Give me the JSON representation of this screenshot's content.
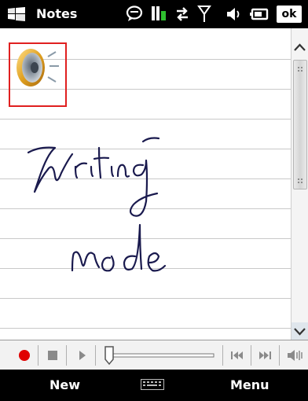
{
  "titlebar": {
    "app_title": "Notes",
    "icons": [
      "windows-flag-icon",
      "messaging-icon",
      "battery-charging-icon",
      "connectivity-icon",
      "signal-icon",
      "volume-icon",
      "battery-icon",
      "ok-button"
    ],
    "ok_label": "ok"
  },
  "notes": {
    "voice_recording": "speaker-icon",
    "handwriting_lines": [
      "Writing",
      "mode"
    ]
  },
  "playback": {
    "controls": [
      "record-button",
      "stop-button",
      "play-button",
      "position-slider",
      "previous-button",
      "next-button",
      "volume-button"
    ],
    "position": 0,
    "record_color": "#e00000"
  },
  "softkeys": {
    "left": "New",
    "right": "Menu",
    "input": "keyboard-icon"
  },
  "colors": {
    "bar_background": "#000000",
    "highlight_frame": "#e02020",
    "ink": "#1a1a4e"
  }
}
